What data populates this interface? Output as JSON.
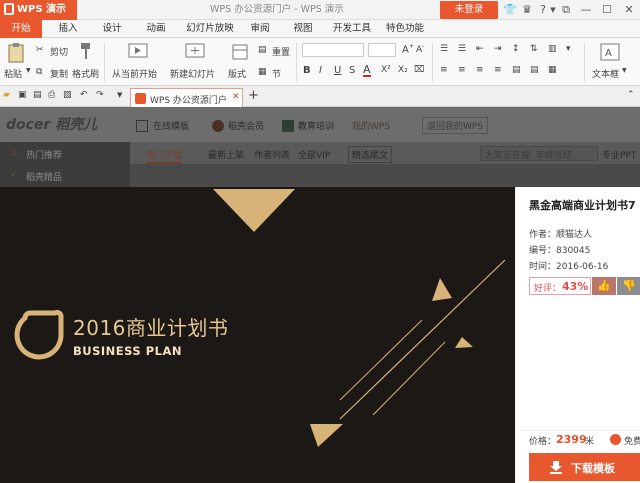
{
  "titlebar": {
    "app_name": "WPS 演示",
    "window_title": "WPS 办公资源门户 - WPS 演示",
    "login_label": "未登录"
  },
  "menu_tabs": [
    "开始",
    "插入",
    "设计",
    "动画",
    "幻灯片放映",
    "审阅",
    "视图",
    "开发工具",
    "特色功能"
  ],
  "ribbon": {
    "paste": "粘贴",
    "cut": "剪切",
    "copy": "复制",
    "format_painter": "格式刷",
    "from_current": "从当前开始",
    "new_slide": "新建幻灯片",
    "layout": "版式",
    "reset": "重置",
    "section": "节",
    "text_box": "文本框",
    "bold": "B",
    "italic": "I",
    "underline": "U",
    "strike": "S",
    "font_color": "A",
    "superscript": "X²",
    "subscript": "X₂"
  },
  "doc_tab": {
    "label": "WPS 办公资源门户"
  },
  "website": {
    "logo": "docer 稻壳儿",
    "nav": [
      "在线模板",
      "稻壳会员",
      "教育培训"
    ],
    "wps_link": "我的WPS",
    "return_label": "返回我的WPS",
    "left_items": [
      "热门推荐",
      "稻壳精品"
    ],
    "sub_tabs": [
      "热门下载",
      "最新上架",
      "作者列表",
      "全部VIP"
    ],
    "filter": "精选尾文",
    "search_placeholder": "大家正在搜: 年终总结",
    "search_pro": "专业PPT"
  },
  "preview": {
    "slide_title": "2016商业计划书",
    "slide_subtitle": "BUSINESS PLAN"
  },
  "side": {
    "title": "黑金高端商业计划书7",
    "author": "作者：顺猫达人",
    "number": "编号：830045",
    "date": "时间：2016-06-16",
    "rating_label": "好评：",
    "rating_value": "43%",
    "price_label": "价格：",
    "price_value": "2399",
    "price_unit": "米",
    "free_label": "免费",
    "download_label": "下载模板"
  },
  "colors": {
    "accent": "#e8572e",
    "gold": "#d7b377",
    "slide_bg": "#1c1816"
  }
}
